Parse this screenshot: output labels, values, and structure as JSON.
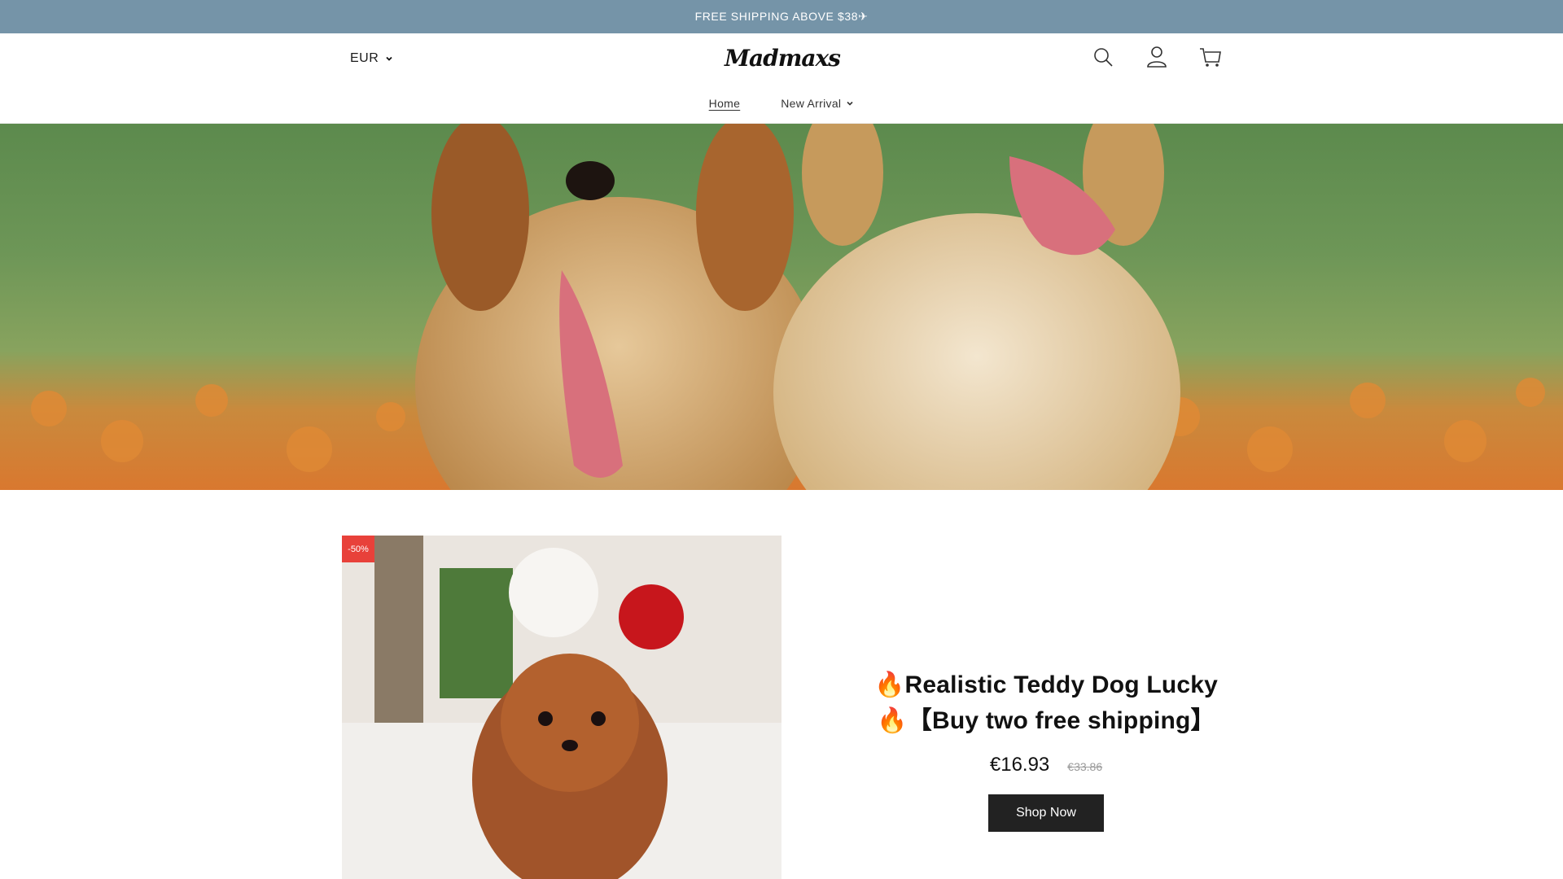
{
  "announcement": {
    "text": "FREE SHIPPING ABOVE $38✈"
  },
  "header": {
    "currency": "EUR",
    "logo": "Madmaxs",
    "icons": [
      "search-icon",
      "account-icon",
      "cart-icon"
    ]
  },
  "nav": {
    "items": [
      {
        "label": "Home"
      },
      {
        "label": "New Arrival"
      }
    ]
  },
  "product": {
    "badge": "-50%",
    "title_line1": "🔥Realistic Teddy Dog Lucky",
    "title_line2": "🔥【Buy two free shipping】",
    "price": "€16.93",
    "old_price": "€33.86",
    "cta": "Shop Now"
  },
  "colors": {
    "announcement_bg": "#7594a8",
    "badge_bg": "#e8413a",
    "button_bg": "#222222"
  }
}
